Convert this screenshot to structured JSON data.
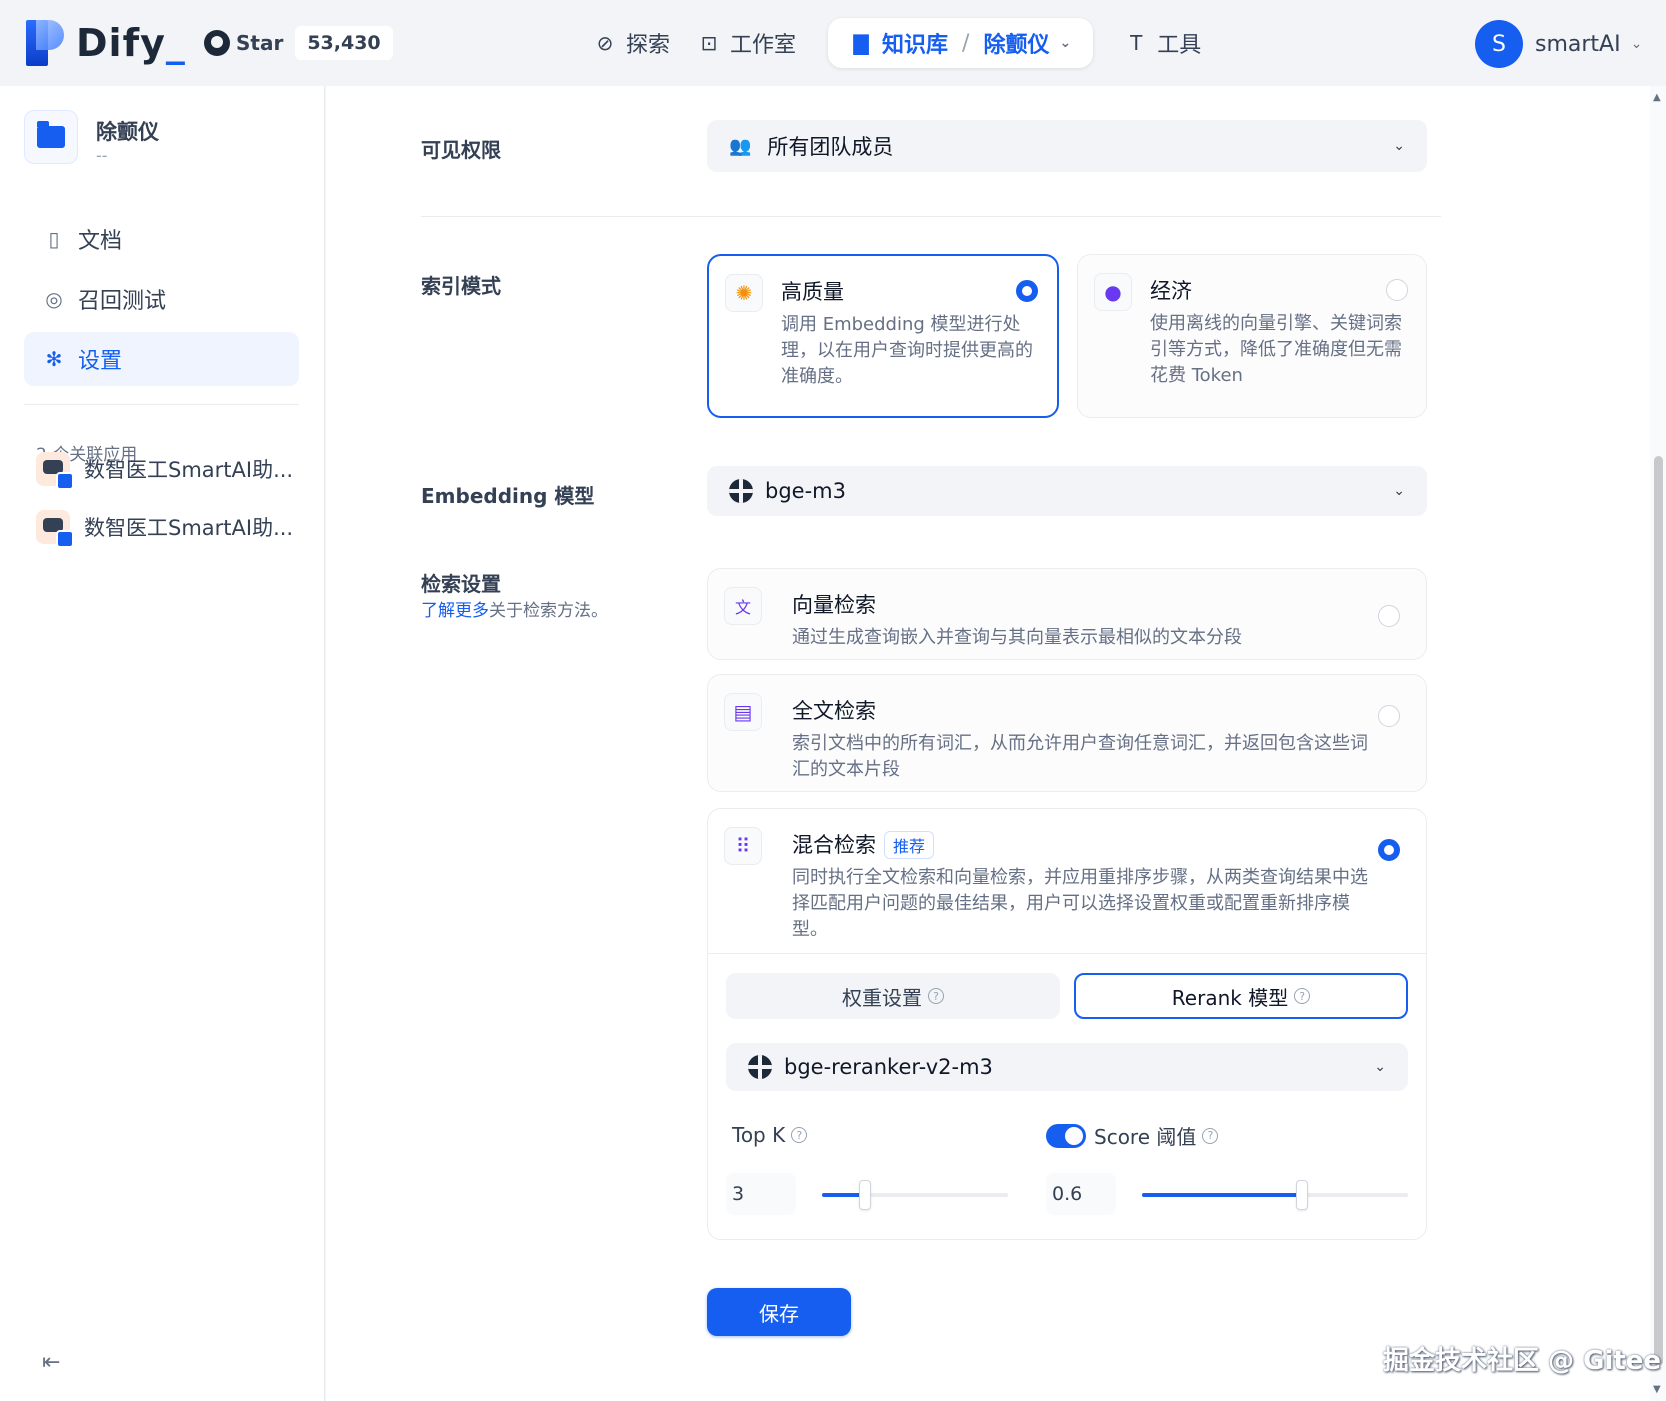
{
  "header": {
    "logo": "Dify",
    "github_star": "Star",
    "github_count": "53,430",
    "nav": {
      "explore": "探索",
      "studio": "工作室",
      "knowledge": "知识库",
      "dataset_sep": "/",
      "dataset": "除颤仪",
      "tools": "工具"
    },
    "user_initial": "S",
    "user_name": "smartAI"
  },
  "sidebar": {
    "dataset_name": "除颤仪",
    "dataset_desc": "--",
    "menu": [
      {
        "label": "文档",
        "icon": "document-icon"
      },
      {
        "label": "召回测试",
        "icon": "target-icon"
      },
      {
        "label": "设置",
        "icon": "gear-icon",
        "active": true
      }
    ],
    "apps_title": "2 个关联应用",
    "apps": [
      {
        "label": "数智医工SmartAI助..."
      },
      {
        "label": "数智医工SmartAI助..."
      }
    ]
  },
  "settings": {
    "permission": {
      "label": "可见权限",
      "value": "所有团队成员"
    },
    "index_mode": {
      "label": "索引模式",
      "options": [
        {
          "title": "高质量",
          "desc": "调用 Embedding 模型进行处理，以在用户查询时提供更高的准确度。",
          "selected": true
        },
        {
          "title": "经济",
          "desc": "使用离线的向量引擎、关键词索引等方式，降低了准确度但无需花费 Token",
          "selected": false
        }
      ]
    },
    "embedding": {
      "label": "Embedding 模型",
      "value": "bge-m3"
    },
    "retrieval": {
      "label": "检索设置",
      "link_text": "了解更多",
      "link_suffix": "关于检索方法。",
      "options": [
        {
          "title": "向量检索",
          "desc": "通过生成查询嵌入并查询与其向量表示最相似的文本分段",
          "selected": false
        },
        {
          "title": "全文检索",
          "desc": "索引文档中的所有词汇，从而允许用户查询任意词汇，并返回包含这些词汇的文本片段",
          "selected": false
        },
        {
          "title": "混合检索",
          "tag": "推荐",
          "desc": "同时执行全文检索和向量检索，并应用重排序步骤，从两类查询结果中选择匹配用户问题的最佳结果，用户可以选择设置权重或配置重新排序模型。",
          "selected": true
        }
      ],
      "tabs": {
        "weights": "权重设置",
        "rerank": "Rerank 模型",
        "active": "rerank"
      },
      "rerank_model": "bge-reranker-v2-m3",
      "top_k": {
        "label": "Top K",
        "value": "3",
        "fraction": 0.23
      },
      "score": {
        "label": "Score 阈值",
        "value": "0.6",
        "enabled": true,
        "fraction": 0.6
      }
    },
    "save_label": "保存"
  },
  "watermark": "掘金技术社区 @ Gitee"
}
